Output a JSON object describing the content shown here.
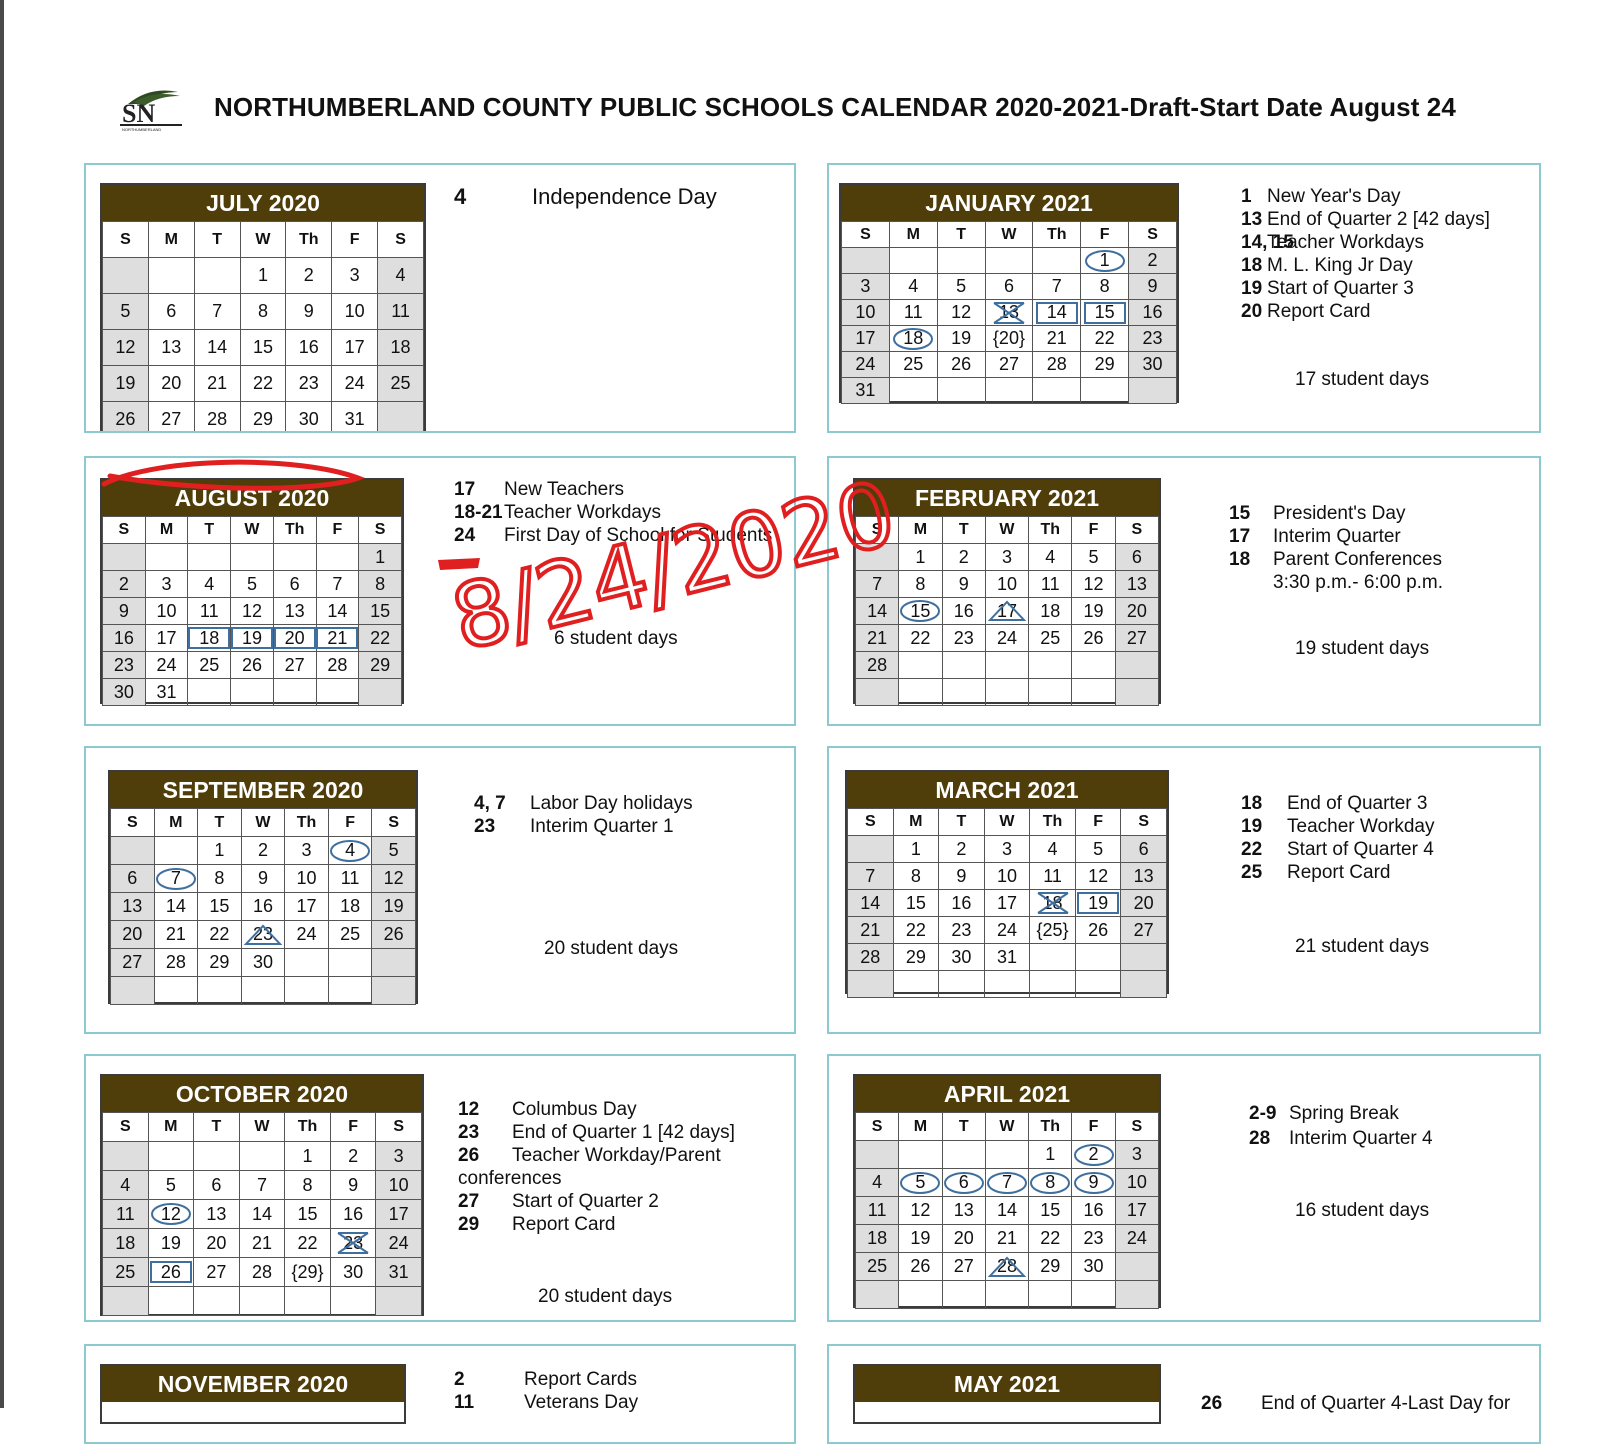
{
  "header": {
    "title": "NORTHUMBERLAND COUNTY PUBLIC SCHOOLS CALENDAR 2020-2021-Draft-Start Date August 24",
    "logo_text": "NORTHUMBERLAND",
    "handwritten_note": "8/24/2020"
  },
  "colors": {
    "header_bg": "#4f3e0a",
    "panel_border": "#8ccad0",
    "marks": "#3f6f9f",
    "annotation": "#e02020"
  },
  "months": [
    {
      "id": "jul",
      "title": "JULY 2020",
      "days": [
        "S",
        "M",
        "T",
        "W",
        "Th",
        "F",
        "S"
      ],
      "weeks": [
        [
          "",
          "",
          "",
          "1",
          "2",
          "3",
          "4"
        ],
        [
          "5",
          "6",
          "7",
          "8",
          "9",
          "10",
          "11"
        ],
        [
          "12",
          "13",
          "14",
          "15",
          "16",
          "17",
          "18"
        ],
        [
          "19",
          "20",
          "21",
          "22",
          "23",
          "24",
          "25"
        ],
        [
          "26",
          "27",
          "28",
          "29",
          "30",
          "31",
          ""
        ]
      ],
      "events": [
        {
          "num": "4",
          "text": "Independence  Day"
        }
      ],
      "student_days": ""
    },
    {
      "id": "jan",
      "title": "JANUARY 2021",
      "days": [
        "S",
        "M",
        "T",
        "W",
        "Th",
        "F",
        "S"
      ],
      "weeks": [
        [
          "",
          "",
          "",
          "",
          "",
          "1",
          "2"
        ],
        [
          "3",
          "4",
          "5",
          "6",
          "7",
          "8",
          "9"
        ],
        [
          "10",
          "11",
          "12",
          "13",
          "14",
          "15",
          "16"
        ],
        [
          "17",
          "18",
          "19",
          "{20}",
          "21",
          "22",
          "23"
        ],
        [
          "24",
          "25",
          "26",
          "27",
          "28",
          "29",
          "30"
        ],
        [
          "31",
          "",
          "",
          "",
          "",
          "",
          ""
        ]
      ],
      "events": [
        {
          "num": "1",
          "text": "New Year's  Day"
        },
        {
          "num": "13",
          "text": "End of Quarter 2 [42 days]"
        },
        {
          "num": "14, 15",
          "text": "Teacher Workdays"
        },
        {
          "num": "18",
          "text": "M. L. King Jr Day"
        },
        {
          "num": "19",
          "text": "Start of Quarter 3"
        },
        {
          "num": "20",
          "text": "Report Card"
        }
      ],
      "student_days": "17  student days"
    },
    {
      "id": "aug",
      "title": "AUGUST 2020",
      "days": [
        "S",
        "M",
        "T",
        "W",
        "Th",
        "F",
        "S"
      ],
      "weeks": [
        [
          "",
          "",
          "",
          "",
          "",
          "",
          "1"
        ],
        [
          "2",
          "3",
          "4",
          "5",
          "6",
          "7",
          "8"
        ],
        [
          "9",
          "10",
          "11",
          "12",
          "13",
          "14",
          "15"
        ],
        [
          "16",
          "17",
          "18",
          "19",
          "20",
          "21",
          "22"
        ],
        [
          "23",
          "24",
          "25",
          "26",
          "27",
          "28",
          "29"
        ],
        [
          "30",
          "31",
          "",
          "",
          "",
          "",
          ""
        ]
      ],
      "events": [
        {
          "num": "17",
          "text": "New Teachers"
        },
        {
          "num": "18-21",
          "text": "Teacher Workdays"
        },
        {
          "num": "24",
          "text": "First Day of School for Students"
        }
      ],
      "student_days": "6 student days"
    },
    {
      "id": "feb",
      "title": "FEBRUARY 2021",
      "days": [
        "S",
        "M",
        "T",
        "W",
        "Th",
        "F",
        "S"
      ],
      "weeks": [
        [
          "",
          "1",
          "2",
          "3",
          "4",
          "5",
          "6"
        ],
        [
          "7",
          "8",
          "9",
          "10",
          "11",
          "12",
          "13"
        ],
        [
          "14",
          "15",
          "16",
          "17",
          "18",
          "19",
          "20"
        ],
        [
          "21",
          "22",
          "23",
          "24",
          "25",
          "26",
          "27"
        ],
        [
          "28",
          "",
          "",
          "",
          "",
          "",
          ""
        ],
        [
          "",
          "",
          "",
          "",
          "",
          "",
          ""
        ]
      ],
      "events": [
        {
          "num": "15",
          "text": "President's  Day"
        },
        {
          "num": "17",
          "text": "Interim Quarter"
        },
        {
          "num": "18",
          "text": "Parent Conferences"
        },
        {
          "num": "",
          "text": "3:30 p.m.-  6:00 p.m."
        }
      ],
      "student_days": "19  student days"
    },
    {
      "id": "sep",
      "title": "SEPTEMBER 2020",
      "days": [
        "S",
        "M",
        "T",
        "W",
        "Th",
        "F",
        "S"
      ],
      "weeks": [
        [
          "",
          "",
          "1",
          "2",
          "3",
          "4",
          "5"
        ],
        [
          "6",
          "7",
          "8",
          "9",
          "10",
          "11",
          "12"
        ],
        [
          "13",
          "14",
          "15",
          "16",
          "17",
          "18",
          "19"
        ],
        [
          "20",
          "21",
          "22",
          "23",
          "24",
          "25",
          "26"
        ],
        [
          "27",
          "28",
          "29",
          "30",
          "",
          "",
          ""
        ],
        [
          "",
          "",
          "",
          "",
          "",
          "",
          ""
        ]
      ],
      "events": [
        {
          "num": "4, 7",
          "text": "Labor Day holidays"
        },
        {
          "num": "23",
          "text": "Interim Quarter 1"
        }
      ],
      "student_days": "20  student days"
    },
    {
      "id": "mar",
      "title": "MARCH 2021",
      "days": [
        "S",
        "M",
        "T",
        "W",
        "Th",
        "F",
        "S"
      ],
      "weeks": [
        [
          "",
          "1",
          "2",
          "3",
          "4",
          "5",
          "6"
        ],
        [
          "7",
          "8",
          "9",
          "10",
          "11",
          "12",
          "13"
        ],
        [
          "14",
          "15",
          "16",
          "17",
          "18",
          "19",
          "20"
        ],
        [
          "21",
          "22",
          "23",
          "24",
          "{25}",
          "26",
          "27"
        ],
        [
          "28",
          "29",
          "30",
          "31",
          "",
          "",
          ""
        ],
        [
          "",
          "",
          "",
          "",
          "",
          "",
          ""
        ]
      ],
      "events": [
        {
          "num": "18",
          "text": "End of Quarter 3"
        },
        {
          "num": "19",
          "text": "Teacher Workday"
        },
        {
          "num": "22",
          "text": "Start of Quarter 4"
        },
        {
          "num": "25",
          "text": "Report Card"
        }
      ],
      "student_days": "21  student days"
    },
    {
      "id": "oct",
      "title": "OCTOBER 2020",
      "days": [
        "S",
        "M",
        "T",
        "W",
        "Th",
        "F",
        "S"
      ],
      "weeks": [
        [
          "",
          "",
          "",
          "",
          "1",
          "2",
          "3"
        ],
        [
          "4",
          "5",
          "6",
          "7",
          "8",
          "9",
          "10"
        ],
        [
          "11",
          "12",
          "13",
          "14",
          "15",
          "16",
          "17"
        ],
        [
          "18",
          "19",
          "20",
          "21",
          "22",
          "23",
          "24"
        ],
        [
          "25",
          "26",
          "27",
          "28",
          "{29}",
          "30",
          "31"
        ],
        [
          "",
          "",
          "",
          "",
          "",
          "",
          ""
        ]
      ],
      "events": [
        {
          "num": "12",
          "text": "Columbus Day"
        },
        {
          "num": "23",
          "text": "End of Quarter 1  [42 days]"
        },
        {
          "num": "26",
          "text": "Teacher Workday/Parent"
        },
        {
          "num": "",
          "text": "conferences"
        },
        {
          "num": "27",
          "text": "Start of Quarter 2"
        },
        {
          "num": "29",
          "text": "Report Card"
        }
      ],
      "student_days": "20 student days"
    },
    {
      "id": "apr",
      "title": "APRIL 2021",
      "days": [
        "S",
        "M",
        "T",
        "W",
        "Th",
        "F",
        "S"
      ],
      "weeks": [
        [
          "",
          "",
          "",
          "",
          "1",
          "2",
          "3"
        ],
        [
          "4",
          "5",
          "6",
          "7",
          "8",
          "9",
          "10"
        ],
        [
          "11",
          "12",
          "13",
          "14",
          "15",
          "16",
          "17"
        ],
        [
          "18",
          "19",
          "20",
          "21",
          "22",
          "23",
          "24"
        ],
        [
          "25",
          "26",
          "27",
          "28",
          "29",
          "30",
          ""
        ],
        [
          "",
          "",
          "",
          "",
          "",
          "",
          ""
        ]
      ],
      "events": [
        {
          "num": "2-9",
          "text": "Spring Break"
        },
        {
          "num": "28",
          "text": "Interim Quarter 4"
        }
      ],
      "student_days": "16  student days"
    },
    {
      "id": "nov",
      "title": "NOVEMBER 2020",
      "days": [],
      "weeks": [],
      "events": [
        {
          "num": "2",
          "text": "Report Cards"
        },
        {
          "num": "11",
          "text": "Veterans Day"
        }
      ],
      "student_days": ""
    },
    {
      "id": "may",
      "title": "MAY 2021",
      "days": [],
      "weeks": [],
      "events": [
        {
          "num": "26",
          "text": "End of Quarter 4-Last Day for"
        }
      ],
      "student_days": ""
    }
  ]
}
